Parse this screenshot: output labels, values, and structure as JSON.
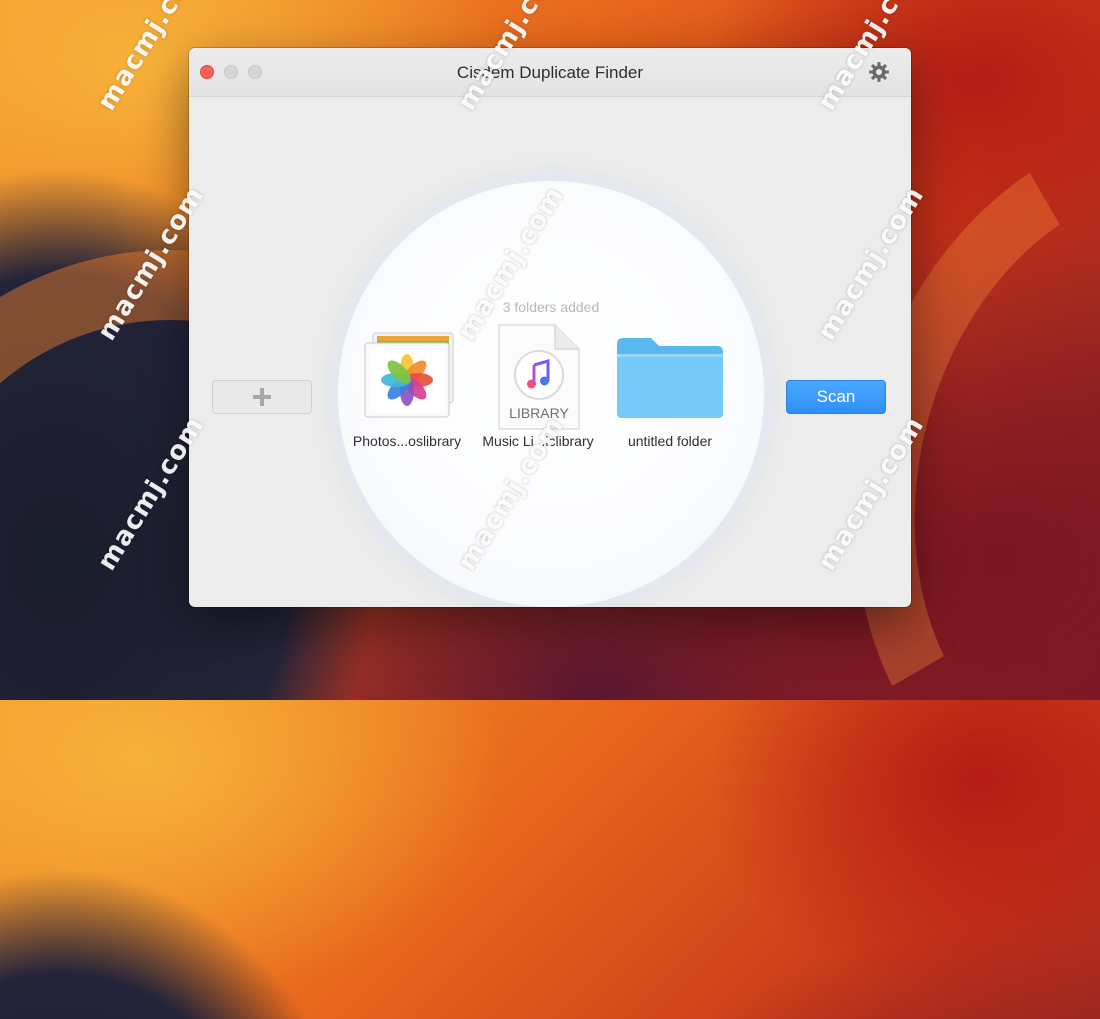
{
  "window": {
    "title": "Cisdem Duplicate Finder"
  },
  "toolbar": {
    "add_label": "+",
    "scan_label": "Scan"
  },
  "drop_zone": {
    "status": "3 folders added",
    "items": [
      {
        "label": "Photos...oslibrary",
        "icon": "photos-library-icon"
      },
      {
        "label": "Music Li...iclibrary",
        "icon": "music-library-icon",
        "badge": "LIBRARY"
      },
      {
        "label": "untitled folder",
        "icon": "folder-icon"
      }
    ]
  },
  "watermark": {
    "text": "macmj.com"
  },
  "colors": {
    "accent": "#2f8ff6",
    "close": "#ff5f57",
    "folder": "#68c2f6"
  }
}
